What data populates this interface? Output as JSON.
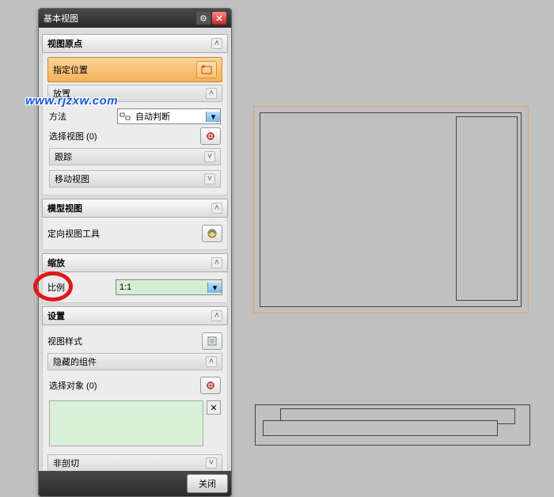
{
  "window": {
    "title": "基本视图"
  },
  "watermark": "www.rjzxw.com",
  "sections": {
    "origin": {
      "title": "视图原点",
      "specify": "指定位置"
    },
    "placement": {
      "title": "放置",
      "method_label": "方法",
      "method_value": "自动判断",
      "select_view": "选择视图 (0)",
      "track": "跟踪",
      "move_view": "移动视图"
    },
    "model_view": {
      "title": "模型视图",
      "orient_tool": "定向视图工具"
    },
    "scale": {
      "title": "缩放",
      "ratio_label": "比例",
      "ratio_value": "1:1"
    },
    "settings": {
      "title": "设置",
      "view_style": "视图样式",
      "hidden_comp": "隐藏的组件",
      "select_obj": "选择对象 (0)",
      "non_section": "非剖切"
    }
  },
  "footer": {
    "close": "关闭"
  }
}
